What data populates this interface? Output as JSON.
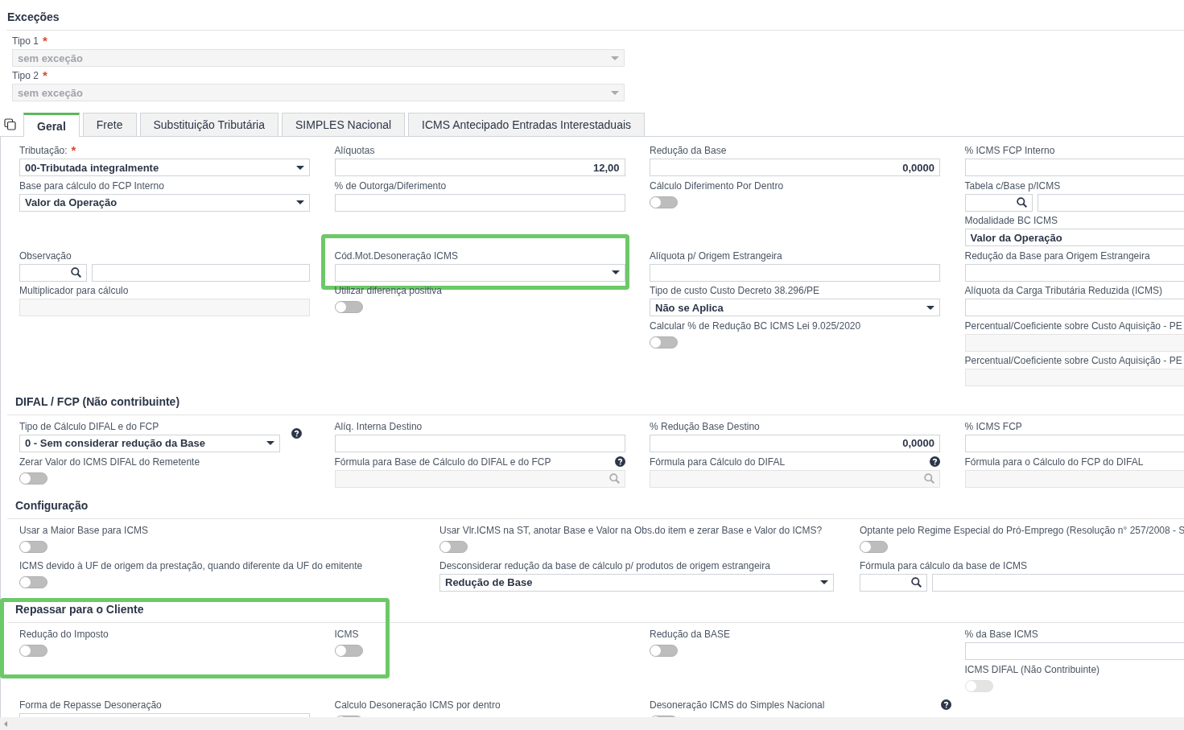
{
  "exceptions": {
    "title": "Exceções",
    "fields": [
      {
        "kind": "select",
        "label": "Tipo 1",
        "required_mark": "*",
        "value": "sem exceção",
        "disabled": true
      },
      {
        "kind": "select",
        "label": "Tipo 2",
        "required_mark": "*",
        "value": "sem exceção",
        "disabled": true
      }
    ]
  },
  "tabs": [
    {
      "label": "Geral",
      "selected": true
    },
    {
      "label": "Frete",
      "selected": false
    },
    {
      "label": "Substituição Tributária",
      "selected": false
    },
    {
      "label": "SIMPLES Nacional",
      "selected": false
    },
    {
      "label": "ICMS Antecipado Entradas Interestaduais",
      "selected": false
    }
  ],
  "general": {
    "columns": [
      [
        {
          "kind": "select",
          "label": "Tributação:",
          "required_mark": "*",
          "value": "00-Tributada integralmente"
        },
        {
          "kind": "select",
          "label": "Base para cálculo do FCP Interno",
          "value": "Valor da Operação"
        },
        {
          "kind": "lookup",
          "label": "Observação"
        },
        {
          "kind": "input",
          "label": "Multiplicador para cálculo",
          "disabled": true
        }
      ],
      [
        {
          "kind": "input",
          "label": "Alíquotas",
          "value": "12,00"
        },
        {
          "kind": "input",
          "label": "% de Outorga/Diferimento"
        },
        {
          "kind": "select",
          "label": "Cód.Mot.Desoneração ICMS",
          "highlight": true
        },
        {
          "kind": "toggle",
          "label": "Utilizar diferença positiva",
          "on": false
        }
      ],
      [
        {
          "kind": "input",
          "label": "Redução da Base",
          "value": "0,0000"
        },
        {
          "kind": "toggle",
          "label": "Cálculo Diferimento Por Dentro",
          "on": false
        },
        {
          "kind": "input",
          "label": "Alíquota p/ Origem Estrangeira"
        },
        {
          "kind": "select",
          "label": "Tipo de custo Custo Decreto 38.296/PE",
          "value": "Não se Aplica"
        },
        {
          "kind": "toggle",
          "label": "Calcular % de Redução BC ICMS Lei 9.025/2020",
          "on": false
        }
      ],
      [
        {
          "kind": "input",
          "label": "% ICMS FCP Interno"
        },
        {
          "kind": "lookup",
          "label": "Tabela c/Base p/ICMS"
        },
        {
          "kind": "select",
          "label": "Modalidade BC ICMS",
          "value": "Valor da Operação"
        },
        {
          "kind": "input",
          "label": "Redução da Base para Origem Estrangeira"
        },
        {
          "kind": "input",
          "label": "Alíquota da Carga Tributária Reduzida (ICMS)"
        },
        {
          "kind": "input",
          "label": "Percentual/Coeficiente sobre Custo Aquisição - PE",
          "disabled": true
        },
        {
          "kind": "input",
          "label": "Percentual/Coeficiente sobre Custo Aquisição - PE",
          "disabled": true
        }
      ]
    ]
  },
  "sections": [
    {
      "title": "DIFAL / FCP (Não contribuinte)",
      "columns": [
        [
          {
            "kind": "select",
            "label": "Tipo de Cálculo DIFAL e do FCP",
            "value": "0 - Sem considerar redução da Base",
            "help": true
          },
          {
            "kind": "toggle",
            "label": "Zerar Valor do ICMS DIFAL do Remetente",
            "on": false
          }
        ],
        [
          {
            "kind": "input",
            "label": "Alíq. Interna Destino"
          },
          {
            "kind": "formula",
            "label": "Fórmula para Base de Cálculo do DIFAL e do FCP",
            "help": true,
            "disabled": true
          }
        ],
        [
          {
            "kind": "input",
            "label": "% Redução Base Destino",
            "value": "0,0000"
          },
          {
            "kind": "formula",
            "label": "Fórmula para Cálculo do DIFAL",
            "help": true,
            "disabled": true
          }
        ],
        [
          {
            "kind": "input",
            "label": "% ICMS FCP"
          },
          {
            "kind": "input",
            "label": "Fórmula para o Cálculo do FCP do DIFAL",
            "disabled": true
          }
        ]
      ]
    },
    {
      "title": "Configuração",
      "columns": [
        [
          {
            "kind": "toggle",
            "label": "Usar a Maior Base para ICMS",
            "on": false
          },
          {
            "kind": "toggle",
            "label": "ICMS devido à UF de origem da prestação, quando diferente da UF do emitente",
            "on": false
          }
        ],
        [
          {
            "kind": "toggle",
            "label": "Usar Vlr.ICMS na ST, anotar Base e Valor na Obs.do item e zerar Base e Valor do ICMS?",
            "on": false
          },
          {
            "kind": "select",
            "label": "Desconsiderar redução da base de cálculo p/ produtos de origem estrangeira",
            "value": "Redução de Base"
          }
        ],
        [
          {
            "kind": "toggle",
            "label": "Optante pelo Regime Especial do Pró-Emprego (Resolução n° 257/2008 - S",
            "on": false
          },
          {
            "kind": "lookup",
            "label": "Fórmula para cálculo da base de ICMS"
          }
        ]
      ]
    },
    {
      "title": "Repassar para o Cliente",
      "highlight": true,
      "columns": [
        [
          {
            "kind": "toggle",
            "label": "Redução do Imposto",
            "on": false
          },
          {
            "kind": "select",
            "label": "Forma de Repasse Desoneração"
          }
        ],
        [
          {
            "kind": "toggle",
            "label": "ICMS",
            "on": false
          },
          {
            "kind": "toggle",
            "label": "Calculo Desoneração ICMS por dentro",
            "on": false
          }
        ],
        [
          {
            "kind": "toggle",
            "label": "Redução da BASE",
            "on": false
          },
          {
            "kind": "toggle",
            "label": "Desoneração ICMS do Simples Nacional",
            "on": false,
            "help": true
          }
        ],
        [
          {
            "kind": "input",
            "label": "% da Base ICMS"
          },
          {
            "kind": "toggle",
            "label": "ICMS DIFAL (Não Contribuinte)",
            "on": false,
            "disabled": true
          }
        ]
      ]
    }
  ]
}
